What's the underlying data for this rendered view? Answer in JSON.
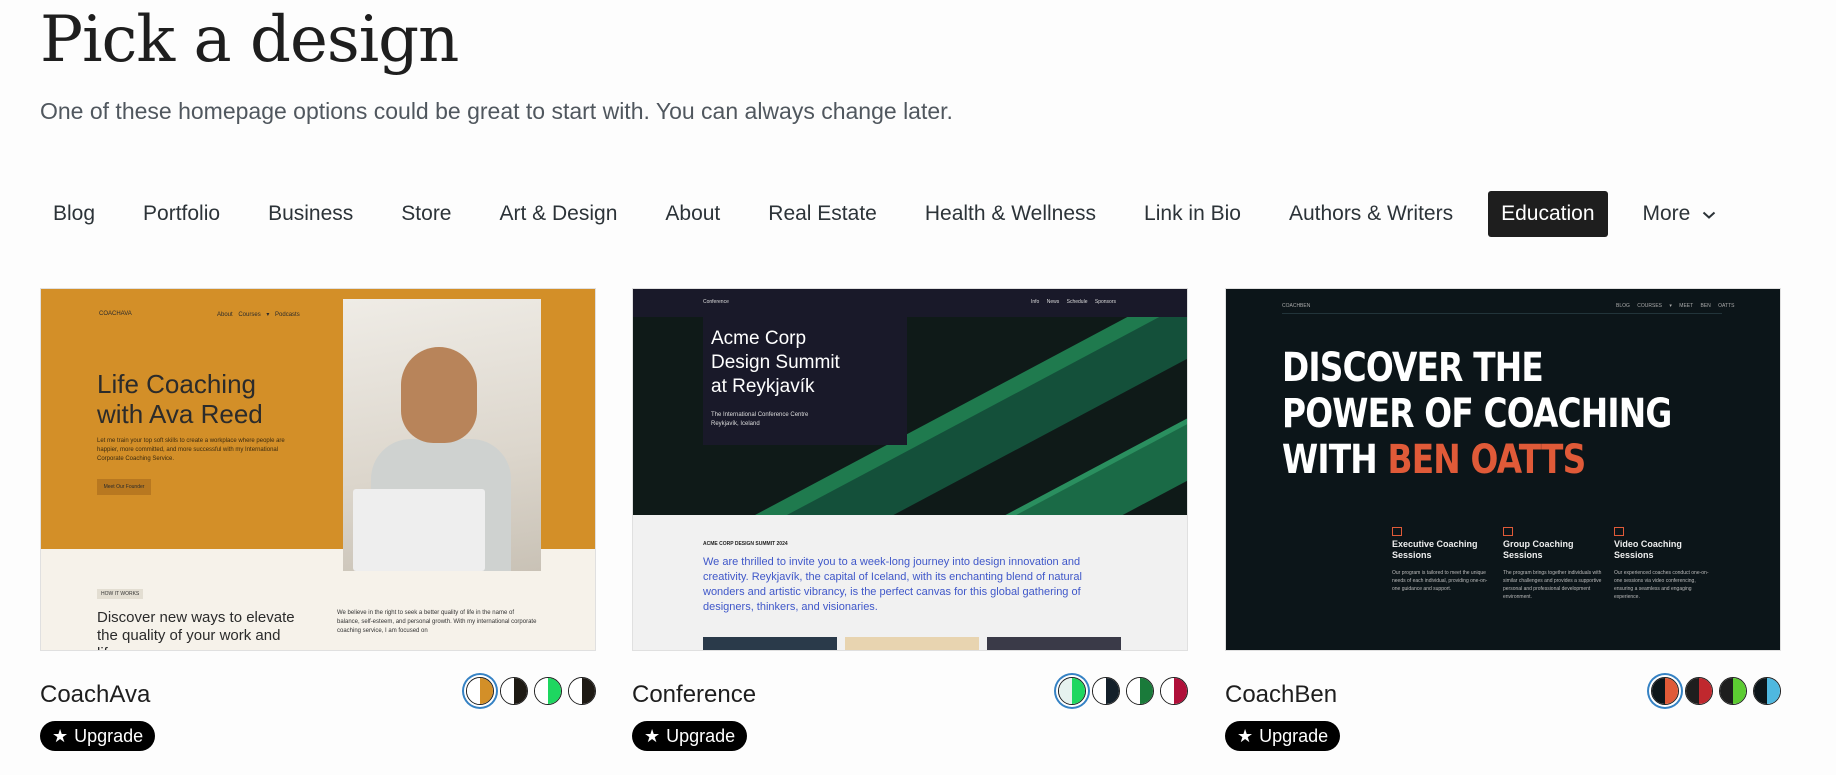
{
  "page": {
    "title": "Pick a design",
    "subtitle": "One of these homepage options could be great to start with. You can always change later."
  },
  "tabs": [
    {
      "label": "Blog"
    },
    {
      "label": "Portfolio"
    },
    {
      "label": "Business"
    },
    {
      "label": "Store"
    },
    {
      "label": "Art & Design"
    },
    {
      "label": "About"
    },
    {
      "label": "Real Estate"
    },
    {
      "label": "Health & Wellness"
    },
    {
      "label": "Link in Bio"
    },
    {
      "label": "Authors & Writers"
    },
    {
      "label": "Education",
      "active": true
    },
    {
      "label": "More"
    }
  ],
  "upgrade_label": "Upgrade",
  "designs": [
    {
      "name": "CoachAva",
      "swatches": [
        [
          "#ffffff",
          "#d38f28"
        ],
        [
          "#ffffff",
          "#1e1a14"
        ],
        [
          "#ffffff",
          "#1ed760"
        ],
        [
          "#ffffff",
          "#1e1a14"
        ]
      ],
      "preview": {
        "logo": "COACHAVA",
        "nav": "About Courses ▾ Podcasts",
        "heading_line1": "Life Coaching",
        "heading_line2": "with Ava Reed",
        "body": "Let me train your top soft skills to create a workplace where people are happier, more committed, and more successful with my International Corporate Coaching Service.",
        "button": "Meet Our Founder",
        "tag": "HOW IT WORKS",
        "section_heading": "Discover new ways to elevate the quality of your work and life",
        "section_body": "We believe in the right to seek a better quality of life in the name of balance, self-esteem, and personal growth. With my international corporate coaching service, I am focused on"
      }
    },
    {
      "name": "Conference",
      "swatches": [
        [
          "#e6f2ef",
          "#1ed760"
        ],
        [
          "#ffffff",
          "#14202a"
        ],
        [
          "#ffffff",
          "#1a7a3a"
        ],
        [
          "#ffffff",
          "#b0103a"
        ]
      ],
      "preview": {
        "logo": "Conference",
        "nav": "Info News Schedule Sponsors",
        "heading_line1": "Acme Corp",
        "heading_line2": "Design Summit",
        "heading_line3": "at Reykjavík",
        "venue_line1": "The International Conference Centre",
        "venue_line2": "Reykjavík, Iceland",
        "eyebrow": "ACME CORP DESIGN SUMMIT 2024",
        "body": "We are thrilled to invite you to a week-long journey into design innovation and creativity. Reykjavík, the capital of Iceland, with its enchanting blend of natural wonders and artistic vibrancy, is the perfect canvas for this global gathering of designers, thinkers, and visionaries."
      }
    },
    {
      "name": "CoachBen",
      "swatches": [
        [
          "#0c1519",
          "#e05a38"
        ],
        [
          "#1e1e1e",
          "#c0282e"
        ],
        [
          "#1e1e1e",
          "#5ccc32"
        ],
        [
          "#0c1519",
          "#4fb8e0"
        ]
      ],
      "preview": {
        "logo": "COACHBEN",
        "nav": "BLOG COURSES ▾ MEET BEN OATTS",
        "heading_line1": "DISCOVER THE",
        "heading_line2": "POWER OF COACHING",
        "heading_line3_a": "WITH ",
        "heading_line3_b": "BEN OATTS",
        "services": [
          {
            "title": "Executive Coaching Sessions",
            "body": "Our program is tailored to meet the unique needs of each individual, providing one-on-one guidance and support."
          },
          {
            "title": "Group Coaching Sessions",
            "body": "The program brings together individuals with similar challenges and provides a supportive personal and professional development environment."
          },
          {
            "title": "Video Coaching Sessions",
            "body": "Our experienced coaches conduct one-on-one sessions via video conferencing, ensuring a seamless and engaging experience."
          }
        ]
      }
    }
  ]
}
